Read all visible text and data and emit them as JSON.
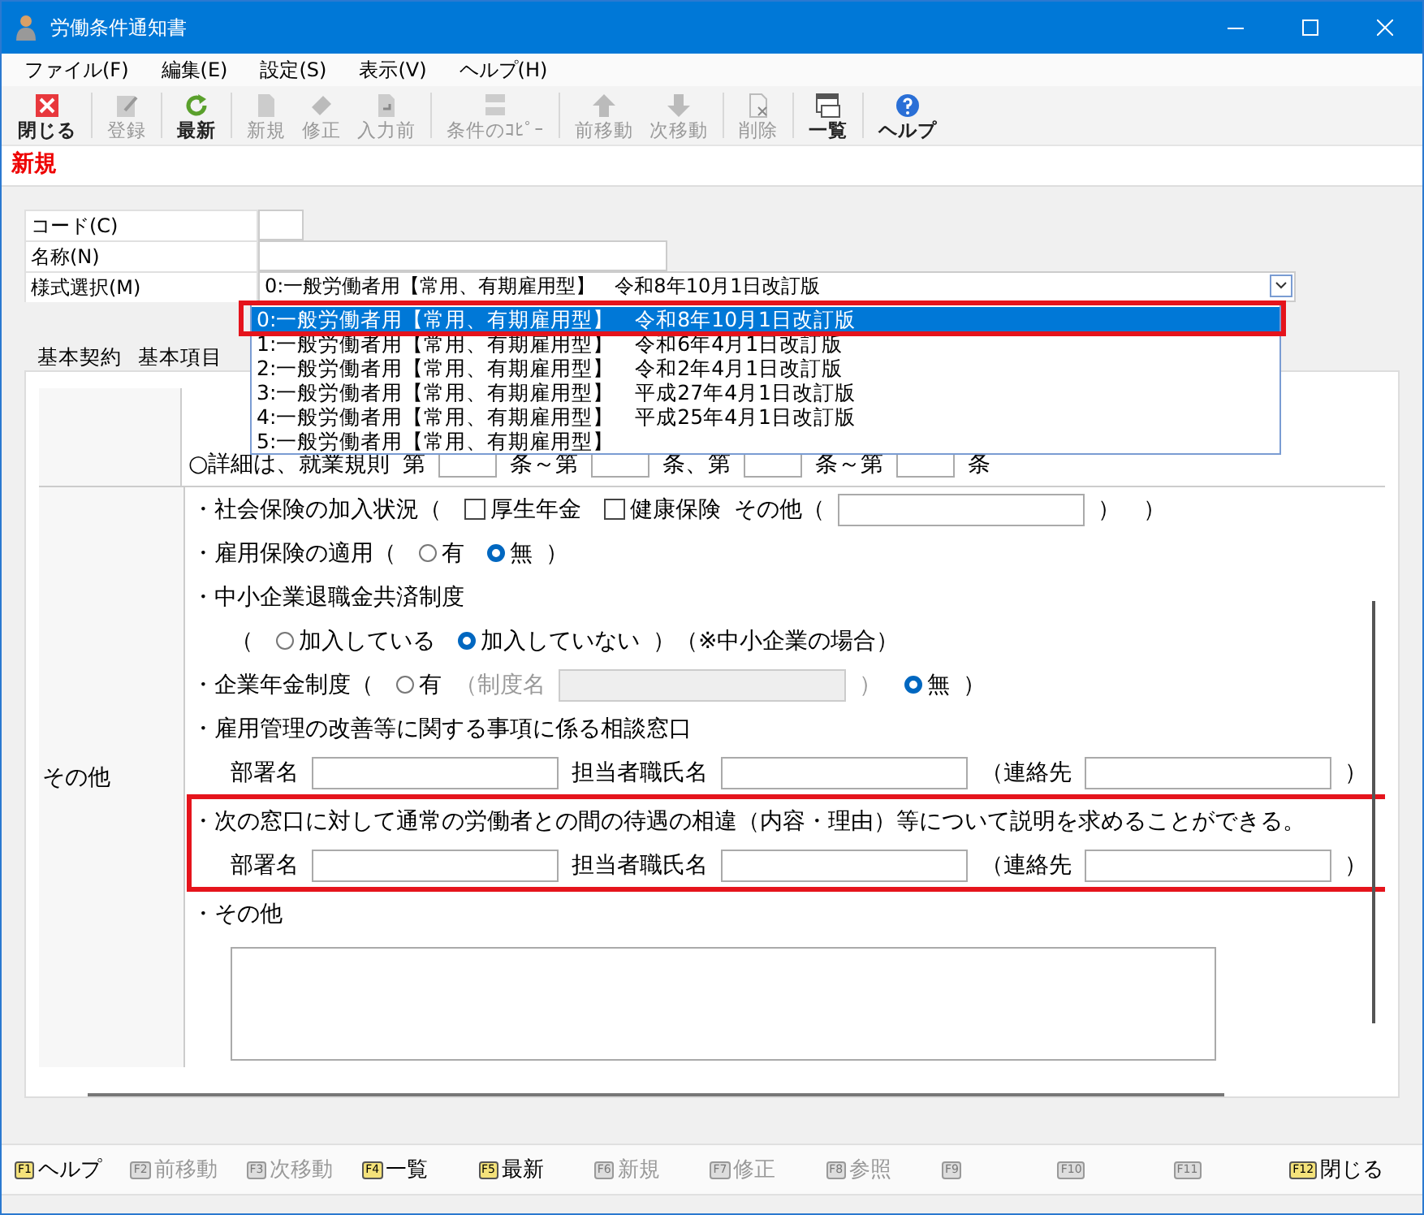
{
  "window": {
    "title": "労働条件通知書"
  },
  "menu": [
    "ファイル(F)",
    "編集(E)",
    "設定(S)",
    "表示(V)",
    "ヘルプ(H)"
  ],
  "toolbar": [
    {
      "label": "閉じる",
      "disabled": false
    },
    {
      "label": "登録",
      "disabled": true
    },
    {
      "label": "最新",
      "disabled": false
    },
    {
      "label": "新規",
      "disabled": true
    },
    {
      "label": "修正",
      "disabled": true
    },
    {
      "label": "入力前",
      "disabled": true
    },
    {
      "label": "条件のｺﾋﾟｰ",
      "disabled": true
    },
    {
      "label": "前移動",
      "disabled": true
    },
    {
      "label": "次移動",
      "disabled": true
    },
    {
      "label": "削除",
      "disabled": true
    },
    {
      "label": "一覧",
      "disabled": false
    },
    {
      "label": "ヘルプ",
      "disabled": false
    }
  ],
  "mode": "新規",
  "form": {
    "code_label": "コード(C)",
    "name_label": "名称(N)",
    "style_label": "様式選択(M)",
    "style_value": "0:一般労働者用【常用、有期雇用型】　令和8年10月1日改訂版",
    "options": [
      {
        "label": "0:一般労働者用【常用、有期雇用型】　令和8年10月1日改訂版",
        "selected": true
      },
      {
        "label": "1:一般労働者用【常用、有期雇用型】　令和6年4月1日改訂版",
        "selected": false
      },
      {
        "label": "2:一般労働者用【常用、有期雇用型】　令和2年4月1日改訂版",
        "selected": false
      },
      {
        "label": "3:一般労働者用【常用、有期雇用型】　平成27年4月1日改訂版",
        "selected": false
      },
      {
        "label": "4:一般労働者用【常用、有期雇用型】　平成25年4月1日改訂版",
        "selected": false
      },
      {
        "label": "5:一般労働者用【常用、有期雇用型】",
        "selected": false
      }
    ]
  },
  "tabs": [
    {
      "label": "基本契約",
      "selected": false
    },
    {
      "label": "基本項目",
      "selected": false
    }
  ],
  "detail_row": [
    {
      "kind": "text",
      "text": "○詳細は、就業規則"
    },
    {
      "kind": "text",
      "text": "第"
    },
    {
      "kind": "blank"
    },
    {
      "kind": "text",
      "text": "条～第"
    },
    {
      "kind": "blank"
    },
    {
      "kind": "text",
      "text": "条、第"
    },
    {
      "kind": "blank"
    },
    {
      "kind": "text",
      "text": "条～第"
    },
    {
      "kind": "blank"
    },
    {
      "kind": "text",
      "text": "条"
    }
  ],
  "section_label": "その他",
  "blocks": [
    {
      "highlighted": false,
      "rows": [
        {
          "kind": "item",
          "items": [
            {
              "kind": "text",
              "text": "・社会保険の加入状況（"
            },
            {
              "kind": "check",
              "label": "厚生年金",
              "checked": false
            },
            {
              "kind": "check",
              "label": "健康保険",
              "checked": false
            },
            {
              "kind": "text",
              "text": "その他（"
            },
            {
              "kind": "field",
              "disabled": false
            },
            {
              "kind": "text",
              "text": "）　）"
            }
          ]
        },
        {
          "kind": "item",
          "items": [
            {
              "kind": "text",
              "text": "・雇用保険の適用（"
            },
            {
              "kind": "radio",
              "label": "有",
              "selected": false
            },
            {
              "kind": "radio",
              "label": "無",
              "selected": true
            },
            {
              "kind": "text",
              "text": "）"
            }
          ]
        },
        {
          "kind": "item",
          "items": [
            {
              "kind": "text",
              "text": "・中小企業退職金共済制度"
            }
          ]
        },
        {
          "kind": "sub",
          "items": [
            {
              "kind": "text",
              "text": "（"
            },
            {
              "kind": "radio",
              "label": "加入している",
              "selected": false
            },
            {
              "kind": "radio",
              "label": "加入していない",
              "selected": true
            },
            {
              "kind": "text",
              "text": "）（※中小企業の場合）"
            }
          ]
        },
        {
          "kind": "item",
          "items": [
            {
              "kind": "text",
              "text": "・企業年金制度（"
            },
            {
              "kind": "radio",
              "label": "有",
              "selected": false
            },
            {
              "kind": "muted",
              "text": "（制度名"
            },
            {
              "kind": "field",
              "disabled": true
            },
            {
              "kind": "muted",
              "text": "）"
            },
            {
              "kind": "radio",
              "label": "無",
              "selected": true
            },
            {
              "kind": "text",
              "text": "）"
            }
          ]
        },
        {
          "kind": "item",
          "items": [
            {
              "kind": "text",
              "text": "・雇用管理の改善等に関する事項に係る相談窓口"
            }
          ]
        },
        {
          "kind": "sub",
          "items": [
            {
              "kind": "text",
              "text": "部署名"
            },
            {
              "kind": "field",
              "disabled": false
            },
            {
              "kind": "text",
              "text": "担当者職氏名"
            },
            {
              "kind": "field",
              "disabled": false
            },
            {
              "kind": "text",
              "text": "（連絡先"
            },
            {
              "kind": "field",
              "disabled": false
            },
            {
              "kind": "text",
              "text": "）"
            }
          ]
        }
      ]
    },
    {
      "highlighted": true,
      "rows": [
        {
          "kind": "item",
          "items": [
            {
              "kind": "text",
              "text": "・次の窓口に対して通常の労働者との間の待遇の相違（内容・理由）等について説明を求めることができる。"
            }
          ]
        },
        {
          "kind": "sub",
          "items": [
            {
              "kind": "text",
              "text": "部署名"
            },
            {
              "kind": "field",
              "disabled": false
            },
            {
              "kind": "text",
              "text": "担当者職氏名"
            },
            {
              "kind": "field",
              "disabled": false
            },
            {
              "kind": "text",
              "text": "（連絡先"
            },
            {
              "kind": "field",
              "disabled": false
            },
            {
              "kind": "text",
              "text": "）"
            }
          ]
        }
      ]
    },
    {
      "highlighted": false,
      "rows": [
        {
          "kind": "item",
          "items": [
            {
              "kind": "text",
              "text": "・その他"
            }
          ]
        },
        {
          "kind": "sub",
          "items": [
            {
              "kind": "area"
            }
          ]
        }
      ]
    }
  ],
  "fkeys": [
    {
      "key": "F1",
      "label": "ヘルプ",
      "disabled": false
    },
    {
      "key": "F2",
      "label": "前移動",
      "disabled": true
    },
    {
      "key": "F3",
      "label": "次移動",
      "disabled": true
    },
    {
      "key": "F4",
      "label": "一覧",
      "disabled": false
    },
    {
      "key": "F5",
      "label": "最新",
      "disabled": false
    },
    {
      "key": "F6",
      "label": "新規",
      "disabled": true
    },
    {
      "key": "F7",
      "label": "修正",
      "disabled": true
    },
    {
      "key": "F8",
      "label": "参照",
      "disabled": true
    },
    {
      "key": "F9",
      "disabled": true
    },
    {
      "key": "F10",
      "disabled": true
    },
    {
      "key": "F11",
      "disabled": true
    },
    {
      "key": "F12",
      "label": "閉じる",
      "disabled": false
    }
  ]
}
